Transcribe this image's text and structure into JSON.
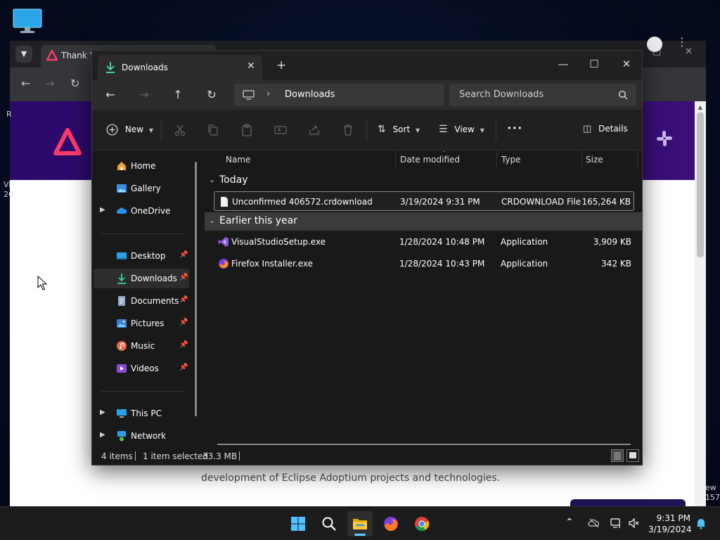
{
  "browser": {
    "tab_title": "Thank Y",
    "body_text": "development of Eclipse Adoptium projects and technologies.",
    "left_fragments": [
      "R",
      "Vi",
      "20"
    ],
    "right_fragments": [
      "ew",
      "157"
    ]
  },
  "explorer": {
    "tab_title": "Downloads",
    "new_tab_symbol": "+",
    "address": "Downloads",
    "search_placeholder": "Search Downloads",
    "commands": {
      "new_label": "New",
      "sort_label": "Sort",
      "view_label": "View",
      "more_label": "•••",
      "details_label": "Details"
    },
    "nav": {
      "items": [
        {
          "label": "Home",
          "icon": "home-icon"
        },
        {
          "label": "Gallery",
          "icon": "gallery-icon"
        },
        {
          "label": "OneDrive",
          "icon": "onedrive-icon"
        },
        {
          "label": "Desktop",
          "icon": "desktop-icon"
        },
        {
          "label": "Downloads",
          "icon": "downloads-icon"
        },
        {
          "label": "Documents",
          "icon": "documents-icon"
        },
        {
          "label": "Pictures",
          "icon": "pictures-icon"
        },
        {
          "label": "Music",
          "icon": "music-icon"
        },
        {
          "label": "Videos",
          "icon": "videos-icon"
        },
        {
          "label": "This PC",
          "icon": "this-pc-icon"
        },
        {
          "label": "Network",
          "icon": "network-icon"
        }
      ]
    },
    "columns": [
      "Name",
      "Date modified",
      "Type",
      "Size"
    ],
    "groups": [
      {
        "label": "Today",
        "files": [
          {
            "name": "Unconfirmed 406572.crdownload",
            "date": "3/19/2024 9:31 PM",
            "type": "CRDOWNLOAD File",
            "size": "165,264 KB"
          }
        ]
      },
      {
        "label": "Earlier this year",
        "files": [
          {
            "name": "VisualStudioSetup.exe",
            "date": "1/28/2024 10:48 PM",
            "type": "Application",
            "size": "3,909 KB"
          },
          {
            "name": "Firefox Installer.exe",
            "date": "1/28/2024 10:43 PM",
            "type": "Application",
            "size": "342 KB"
          }
        ]
      }
    ],
    "status": {
      "items": "4 items",
      "selected": "1 item selected",
      "size": "33.3 MB"
    }
  },
  "taskbar": {
    "time": "9:31 PM",
    "date": "3/19/2024"
  },
  "colors": {
    "accent": "#60cdff",
    "explorer_bg": "#191919",
    "hero_purple": "#3a0f78"
  }
}
